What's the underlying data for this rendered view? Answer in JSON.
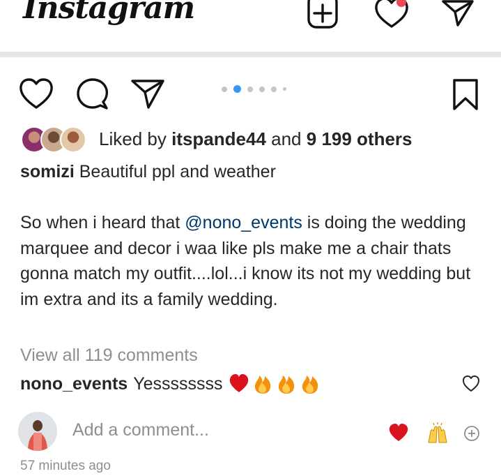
{
  "app": {
    "title": "Instagram"
  },
  "header_icons": [
    "new-post-icon",
    "activity-heart-icon",
    "direct-message-icon"
  ],
  "actions": [
    "like-icon",
    "comment-icon",
    "share-icon",
    "bookmark-icon"
  ],
  "carousel": {
    "count": 6,
    "active": 2
  },
  "likes": {
    "prefix": "Liked by",
    "user": "itspande44",
    "joiner": "and",
    "others": "9 199 others"
  },
  "caption": {
    "username": "somizi",
    "line1": "Beautiful ppl and weather",
    "para_pre": "So when i heard that",
    "mention": "@nono_events",
    "para_post": "is doing the wedding marquee and decor i waa like pls make me a chair thats gonna match my outfit....lol...i know its not my wedding but im extra and its a family wedding."
  },
  "view_all": "View all 119 comments",
  "comment": {
    "username": "nono_events",
    "text": "Yessssssss",
    "emojis": [
      "red-heart",
      "fire",
      "fire",
      "fire"
    ]
  },
  "add_comment": {
    "placeholder": "Add a comment...",
    "quick_emojis": [
      "red-heart",
      "raising-hands"
    ]
  },
  "timestamp": "57 minutes ago",
  "colors": {
    "notification": "#ed4956",
    "link": "#00376b",
    "carousel_active": "#3897f0",
    "muted": "#8e8e8e"
  }
}
